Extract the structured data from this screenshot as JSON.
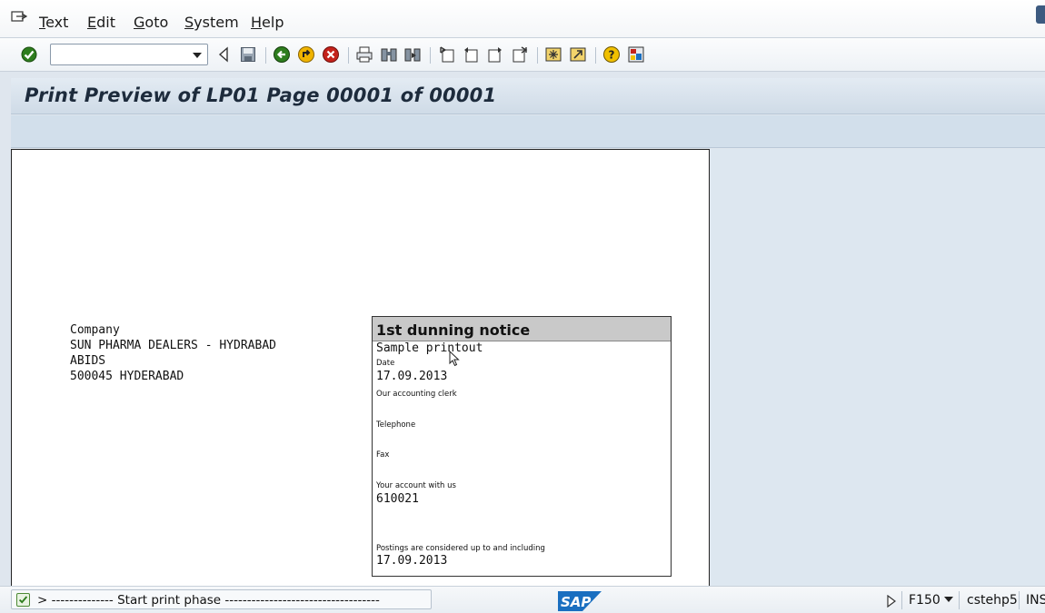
{
  "menu": {
    "items": [
      {
        "key": "T",
        "rest": "ext"
      },
      {
        "key": "E",
        "rest": "dit"
      },
      {
        "key": "G",
        "rest": "oto"
      },
      {
        "key": "S",
        "rest": "ystem"
      },
      {
        "key": "H",
        "rest": "elp"
      }
    ]
  },
  "toolbar": {
    "command_value": "",
    "icons": [
      "enter-icon",
      "back-triangle-icon",
      "save-icon",
      "back-icon",
      "exit-icon",
      "cancel-icon",
      "print-icon",
      "find-icon",
      "find-next-icon",
      "first-page-icon",
      "previous-page-icon",
      "next-page-icon",
      "last-page-icon",
      "create-session-icon",
      "shortcut-icon",
      "help-icon",
      "layout-icon"
    ]
  },
  "title": "Print Preview of LP01 Page 00001 of 00001",
  "document": {
    "address": [
      "Company",
      "SUN PHARMA DEALERS - HYDRABAD",
      "ABIDS",
      "500045 HYDERABAD"
    ],
    "notice_title": "1st dunning notice",
    "notice_subtitle": "Sample printout",
    "date_label": "Date",
    "date_value": "17.09.2013",
    "clerk_label": "Our accounting clerk",
    "telephone_label": "Telephone",
    "fax_label": "Fax",
    "account_label": "Your account with us",
    "account_value": "610021",
    "postings_label": "Postings are considered up to and including",
    "postings_value": "17.09.2013"
  },
  "status": {
    "message": "> -------------- Start print phase -----------------------------------",
    "logo": "SAP",
    "transaction": "F150",
    "server": "cstehp5",
    "mode": "INS"
  },
  "colors": {
    "title_bg": "#d4dfea",
    "sap_blue": "#1a6fc0",
    "ok_green": "#2e7d1e"
  }
}
